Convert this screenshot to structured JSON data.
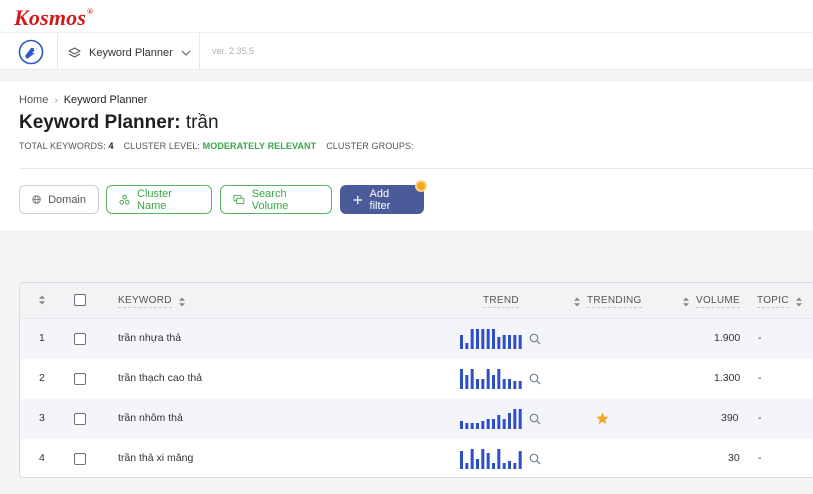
{
  "brand": {
    "name": "Kosmos",
    "mark": "®"
  },
  "appbar": {
    "product": "Keyword Planner",
    "version": "ver. 2.35.5"
  },
  "breadcrumb": {
    "home": "Home",
    "separator": "›",
    "current": "Keyword Planner"
  },
  "title": {
    "main": "Keyword Planner:",
    "query": "trần"
  },
  "meta": {
    "total_label": "TOTAL KEYWORDS:",
    "total_value": "4",
    "cluster_label": "CLUSTER LEVEL:",
    "cluster_value": "MODERATELY RELEVANT",
    "groups_label": "CLUSTER GROUPS:"
  },
  "filters": {
    "domain": "Domain",
    "cluster": "Cluster Name",
    "volume": "Search Volume",
    "add": "Add filter"
  },
  "table": {
    "headers": {
      "keyword": "KEYWORD",
      "trend": "TREND",
      "trending": "TRENDING",
      "volume": "VOLUME",
      "topic": "TOPIC"
    },
    "rows": [
      {
        "num": "1",
        "keyword": "trần nhựa thả",
        "trend": [
          7,
          3,
          10,
          10,
          10,
          10,
          10,
          6,
          7,
          7,
          7,
          7
        ],
        "trending": false,
        "volume": "1.900",
        "topic": "-"
      },
      {
        "num": "2",
        "keyword": "trần thạch cao thả",
        "trend": [
          10,
          7,
          10,
          5,
          5,
          10,
          7,
          10,
          5,
          5,
          4,
          4
        ],
        "trending": false,
        "volume": "1.300",
        "topic": "-"
      },
      {
        "num": "3",
        "keyword": "trần nhôm thả",
        "trend": [
          4,
          3,
          3,
          3,
          4,
          5,
          5,
          7,
          5,
          8,
          10,
          10
        ],
        "trending": true,
        "volume": "390",
        "topic": "-"
      },
      {
        "num": "4",
        "keyword": "trần thả xi măng",
        "trend": [
          9,
          3,
          10,
          5,
          10,
          8,
          3,
          10,
          3,
          4,
          3,
          9
        ],
        "trending": false,
        "volume": "30",
        "topic": "-"
      }
    ]
  },
  "colors": {
    "brand_red": "#d11a1a",
    "accent_green": "#3aa744",
    "primary_button": "#4b5b9a",
    "trend_bar": "#2f4fc4",
    "star": "#f5a623"
  }
}
